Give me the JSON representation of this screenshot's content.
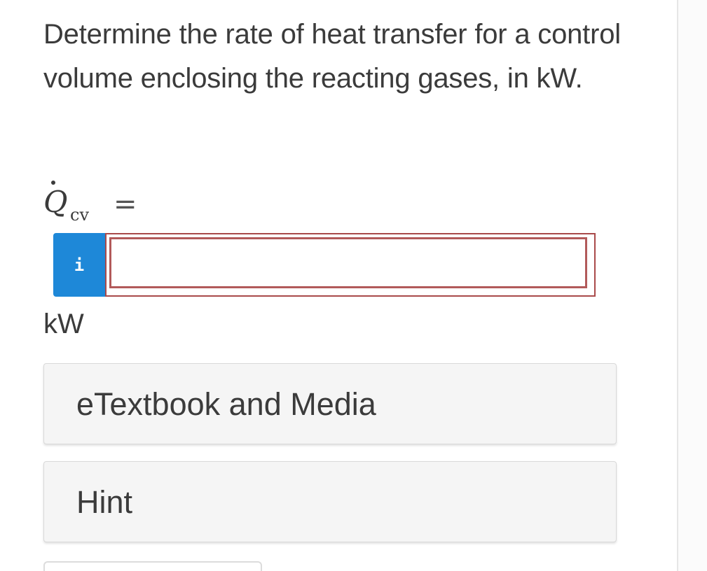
{
  "question": {
    "text": "Determine the rate of heat transfer for a control volume enclosing the reacting gases, in kW."
  },
  "equation": {
    "symbol": "Q",
    "subscript": "cv",
    "equals": "="
  },
  "answer": {
    "info_icon_label": "i",
    "value": "",
    "placeholder": ""
  },
  "unit": "kW",
  "buttons": {
    "etextbook_label": "eTextbook and Media",
    "hint_label": "Hint"
  },
  "colors": {
    "info_button": "#1e88d8",
    "input_error_border": "#b25a5a",
    "panel_background": "#f5f5f5"
  }
}
